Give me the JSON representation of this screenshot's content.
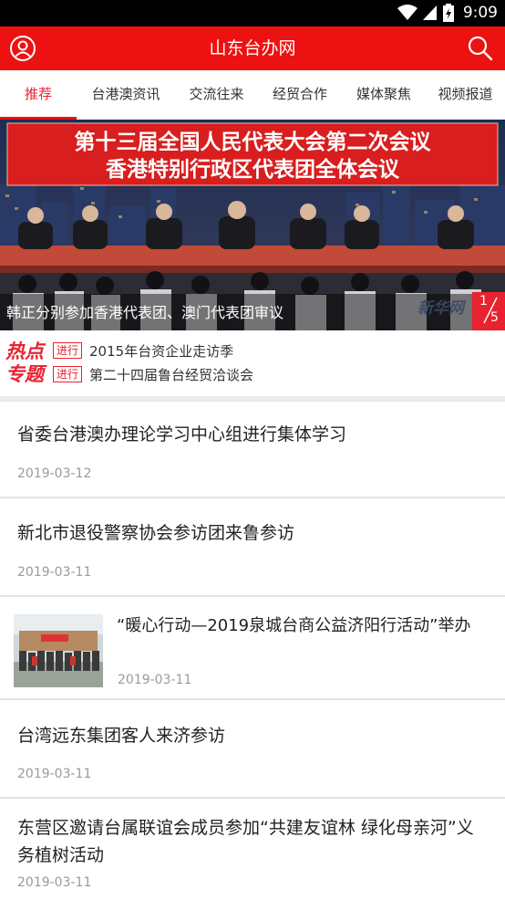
{
  "status_bar": {
    "time": "9:09"
  },
  "app_bar": {
    "title": "山东台办网"
  },
  "tabs": [
    {
      "label": "推荐"
    },
    {
      "label": "台港澳资讯"
    },
    {
      "label": "交流往来"
    },
    {
      "label": "经贸合作"
    },
    {
      "label": "媒体聚焦"
    },
    {
      "label": "视频报道"
    }
  ],
  "banner": {
    "headline_line1": "第十三届全国人民代表大会第二次会议",
    "headline_line2": "香港特别行政区代表团全体会议",
    "caption": "韩正分别参加香港代表团、澳门代表团审议",
    "watermark": "新华网",
    "page_current": "1",
    "page_total": "5"
  },
  "hot_topics": {
    "badge_line1": "热点",
    "badge_line2": "专题",
    "items": [
      {
        "tag": "进行",
        "text": "2015年台资企业走访季"
      },
      {
        "tag": "进行",
        "text": "第二十四届鲁台经贸洽谈会"
      }
    ]
  },
  "feed": [
    {
      "title": "省委台港澳办理论学习中心组进行集体学习",
      "date": "2019-03-12"
    },
    {
      "title": "新北市退役警察协会参访团来鲁参访",
      "date": "2019-03-11"
    },
    {
      "title": "“暖心行动—2019泉城台商公益济阳行活动”举办",
      "date": "2019-03-11",
      "thumbnail_icon": "group-photo"
    },
    {
      "title": "台湾远东集团客人来济参访",
      "date": "2019-03-11"
    },
    {
      "title": "东营区邀请台属联谊会成员参加“共建友谊林 绿化母亲河”义务植树活动",
      "date": "2019-03-11"
    }
  ],
  "colors": {
    "brand_red": "#ee1111",
    "accent_red": "#e8232f",
    "date_gray": "#9a9a9a"
  }
}
